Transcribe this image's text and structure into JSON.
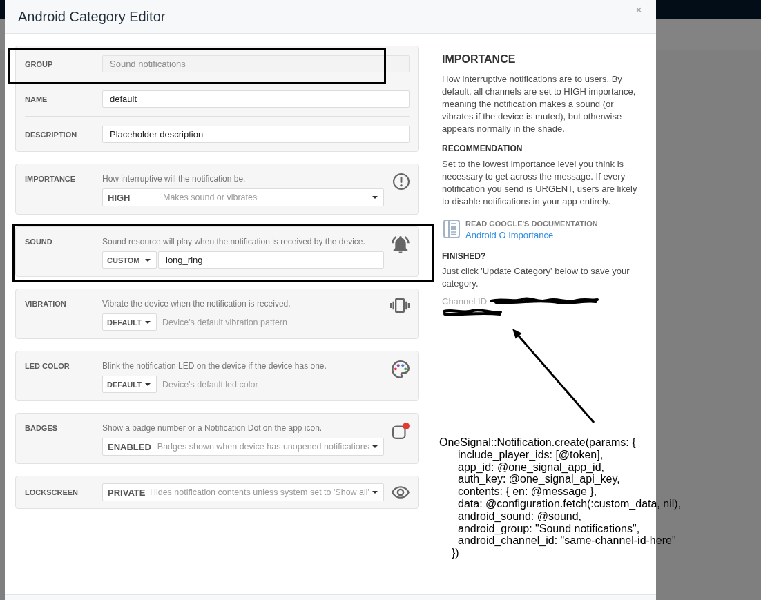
{
  "window": {
    "title": "Android Category Editor",
    "close": "×"
  },
  "general": {
    "fields": [
      {
        "label": "GROUP",
        "value": "Sound notifications",
        "disabled": true,
        "highlighted": true
      },
      {
        "label": "NAME",
        "value": "default",
        "disabled": false,
        "highlighted": false
      },
      {
        "label": "DESCRIPTION",
        "value": "Placeholder description",
        "disabled": false,
        "highlighted": false
      }
    ]
  },
  "settings": [
    {
      "kind": "wide_select",
      "label": "IMPORTANCE",
      "description": "How interruptive will the notification be.",
      "value": "HIGH",
      "detail": "Makes sound or vibrates",
      "highlighted": false
    },
    {
      "kind": "select_input",
      "label": "SOUND",
      "description": "Sound resource will play when the notification is received by the device.",
      "value": "CUSTOM",
      "input_value": "long_ring",
      "highlighted": true
    },
    {
      "kind": "select_note",
      "label": "VIBRATION",
      "description": "Vibrate the device when the notification is received.",
      "value": "DEFAULT",
      "note": "Device's default vibration pattern",
      "highlighted": false
    },
    {
      "kind": "select_note",
      "label": "LED COLOR",
      "description": "Blink the notification LED on the device if the device has one.",
      "value": "DEFAULT",
      "note": "Device's default led color",
      "highlighted": false
    },
    {
      "kind": "wide_select",
      "label": "BADGES",
      "description": "Show a badge number or a Notification Dot on the app icon.",
      "value": "ENABLED",
      "detail": "Badges shown when device has unopened notifications",
      "highlighted": false
    },
    {
      "kind": "wide_select",
      "label": "LOCKSCREEN",
      "value": "PRIVATE",
      "detail": "Hides notification contents unless system set to 'Show all'",
      "highlighted": false
    }
  ],
  "help": {
    "heading": "IMPORTANCE",
    "intro": "How interruptive notifications are to users. By default, all channels are set to HIGH importance, meaning the notification makes a sound (or vibrates if the device is muted), but otherwise appears normally in the shade.",
    "recommendation_heading": "RECOMMENDATION",
    "recommendation": "Set to the lowest importance level you think is necessary to get across the message. If every notification you send is URGENT, users are likely to disable notifications in your app entirely.",
    "doc_caption": "READ GOOGLE'S DOCUMENTATION",
    "doc_link": "Android O Importance",
    "finished_heading": "FINISHED?",
    "finished_text": "Just click 'Update Category' below to save your category.",
    "channel_id_label": "Channel ID",
    "channel_id_redacted": true
  },
  "annotation": {
    "code_opening": "OneSignal::Notification.create(params: {",
    "code_lines": [
      "include_player_ids: [@token],",
      "app_id: @one_signal_app_id,",
      "auth_key: @one_signal_api_key,",
      "contents: { en: @message },",
      "data: @configuration.fetch(:custom_data, nil),",
      "android_sound: @sound,",
      "android_group: \"Sound notifications\",",
      "android_channel_id: \"same-channel-id-here\""
    ],
    "code_closing": "})"
  }
}
